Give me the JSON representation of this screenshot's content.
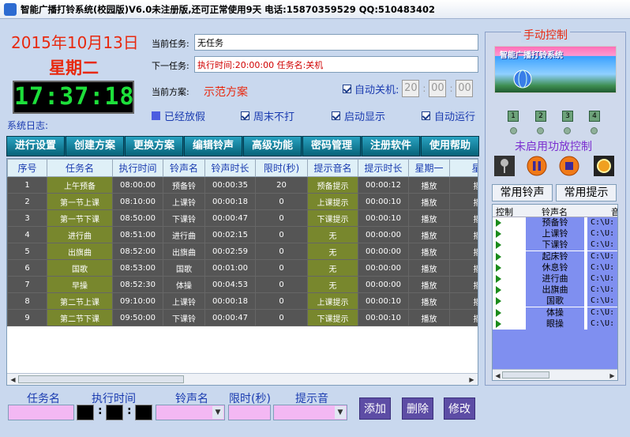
{
  "window": {
    "title": "智能广播打铃系统(校园版)V6.0未注册版,还可正常使用9天 电话:15870359529 QQ:510483402"
  },
  "datetime": {
    "date": "2015年10月13日",
    "weekday": "星期二",
    "clock": "17:37:18"
  },
  "tasks": {
    "current_label": "当前任务:",
    "current_value": "无任务",
    "next_label": "下一任务:",
    "next_value": "执行时间:20:00:00 任务名:关机"
  },
  "plan": {
    "label": "当前方案:",
    "value": "示范方案"
  },
  "auto_shutdown": {
    "label": "自动关机:",
    "hh": "20",
    "mm": "00",
    "ss": "00"
  },
  "options": {
    "holiday": "已经放假",
    "weekend_off": "周末不打",
    "startup_show": "启动显示",
    "auto_run": "自动运行"
  },
  "log_label": "系统日志:",
  "toolbar": [
    "进行设置",
    "创建方案",
    "更换方案",
    "编辑铃声",
    "高级功能",
    "密码管理",
    "注册软件",
    "使用帮助"
  ],
  "grid": {
    "columns": [
      "序号",
      "任务名",
      "执行时间",
      "铃声名",
      "铃声时长",
      "限时(秒)",
      "提示音名",
      "提示时长",
      "星期一",
      "星期"
    ],
    "rows": [
      [
        "1",
        "上午预备",
        "08:00:00",
        "预备铃",
        "00:00:35",
        "20",
        "预备提示",
        "00:00:12",
        "播放",
        "播放"
      ],
      [
        "2",
        "第一节上课",
        "08:10:00",
        "上课铃",
        "00:00:18",
        "0",
        "上课提示",
        "00:00:10",
        "播放",
        "播放"
      ],
      [
        "3",
        "第一节下课",
        "08:50:00",
        "下课铃",
        "00:00:47",
        "0",
        "下课提示",
        "00:00:10",
        "播放",
        "播放"
      ],
      [
        "4",
        "进行曲",
        "08:51:00",
        "进行曲",
        "00:02:15",
        "0",
        "无",
        "00:00:00",
        "播放",
        "播放"
      ],
      [
        "5",
        "出旗曲",
        "08:52:00",
        "出旗曲",
        "00:02:59",
        "0",
        "无",
        "00:00:00",
        "播放",
        "播放"
      ],
      [
        "6",
        "国歌",
        "08:53:00",
        "国歌",
        "00:01:00",
        "0",
        "无",
        "00:00:00",
        "播放",
        "播放"
      ],
      [
        "7",
        "早操",
        "08:52:30",
        "体操",
        "00:04:53",
        "0",
        "无",
        "00:00:00",
        "播放",
        "播放"
      ],
      [
        "8",
        "第二节上课",
        "09:10:00",
        "上课铃",
        "00:00:18",
        "0",
        "上课提示",
        "00:00:10",
        "播放",
        "播放"
      ],
      [
        "9",
        "第二节下课",
        "09:50:00",
        "下课铃",
        "00:00:47",
        "0",
        "下课提示",
        "00:00:10",
        "播放",
        "播放"
      ]
    ]
  },
  "bottom": {
    "task_name": "任务名",
    "exec_time": "执行时间",
    "ring_name": "铃声名",
    "limit": "限时(秒)",
    "prompt": "提示音",
    "add": "添加",
    "delete": "删除",
    "modify": "修改"
  },
  "manual": {
    "title": "手动控制",
    "banner_text": "智能广播打铃系统",
    "channels": [
      "1",
      "2",
      "3",
      "4"
    ],
    "amp_status": "未启用功放控制",
    "common_rings": "常用铃声",
    "common_prompts": "常用提示",
    "list_headers": [
      "控制",
      "铃声名",
      "音"
    ],
    "rings": [
      "预备铃",
      "上课铃",
      "下课铃",
      "起床铃",
      "休息铃",
      "进行曲",
      "出旗曲",
      "国歌",
      "体操",
      "眼操"
    ],
    "path": "C:\\U:"
  },
  "colors": {
    "accent_red": "#e8290f",
    "clock_green": "#1de03a",
    "toolbar": "#0b6a86",
    "row_dark": "#555555",
    "row_olive": "#78872d",
    "ring_blue": "#7f8ff0"
  }
}
